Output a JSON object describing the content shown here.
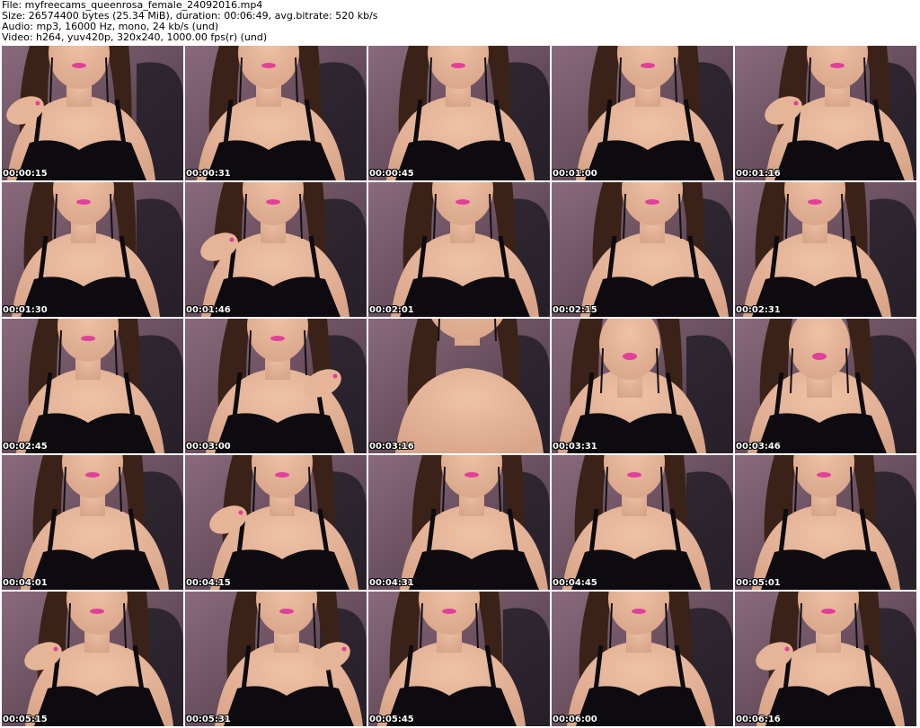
{
  "header": {
    "file_line": "File: myfreecams_queenrosa_female_24092016.mp4",
    "size_line": "Size: 26574400 bytes (25.34 MiB), duration: 00:06:49, avg.bitrate: 520 kb/s",
    "audio_line": "Audio: mp3, 16000 Hz, mono, 24 kb/s (und)",
    "video_line": "Video: h264, yuv420p, 320x240, 1000.00 fps(r) (und)"
  },
  "grid": {
    "columns": 5,
    "rows": 5
  },
  "colors": {
    "background": "#ffffff",
    "text": "#000000",
    "timestamp": "#ffffff",
    "backdrop": "#8a6a7c",
    "dress": "#0d0b10",
    "skin": "#d9a589",
    "hair": "#3b2218",
    "lips": "#e0409a"
  },
  "thumbnails": [
    {
      "time": "00:00:15",
      "scene": "hand"
    },
    {
      "time": "00:00:31",
      "scene": "portrait"
    },
    {
      "time": "00:00:45",
      "scene": "portrait"
    },
    {
      "time": "00:01:00",
      "scene": "portrait"
    },
    {
      "time": "00:01:16",
      "scene": "hand"
    },
    {
      "time": "00:01:30",
      "scene": "portrait"
    },
    {
      "time": "00:01:46",
      "scene": "hand"
    },
    {
      "time": "00:02:01",
      "scene": "portrait"
    },
    {
      "time": "00:02:15",
      "scene": "portrait"
    },
    {
      "time": "00:02:31",
      "scene": "portrait"
    },
    {
      "time": "00:02:45",
      "scene": "portrait"
    },
    {
      "time": "00:03:00",
      "scene": "hand"
    },
    {
      "time": "00:03:16",
      "scene": "closeup"
    },
    {
      "time": "00:03:31",
      "scene": "smile"
    },
    {
      "time": "00:03:46",
      "scene": "smile"
    },
    {
      "time": "00:04:01",
      "scene": "portrait"
    },
    {
      "time": "00:04:15",
      "scene": "hand"
    },
    {
      "time": "00:04:31",
      "scene": "portrait"
    },
    {
      "time": "00:04:45",
      "scene": "portrait"
    },
    {
      "time": "00:05:01",
      "scene": "portrait"
    },
    {
      "time": "00:05:15",
      "scene": "hand"
    },
    {
      "time": "00:05:31",
      "scene": "hand"
    },
    {
      "time": "00:05:45",
      "scene": "portrait"
    },
    {
      "time": "00:06:00",
      "scene": "portrait"
    },
    {
      "time": "00:06:16",
      "scene": "hand"
    }
  ]
}
